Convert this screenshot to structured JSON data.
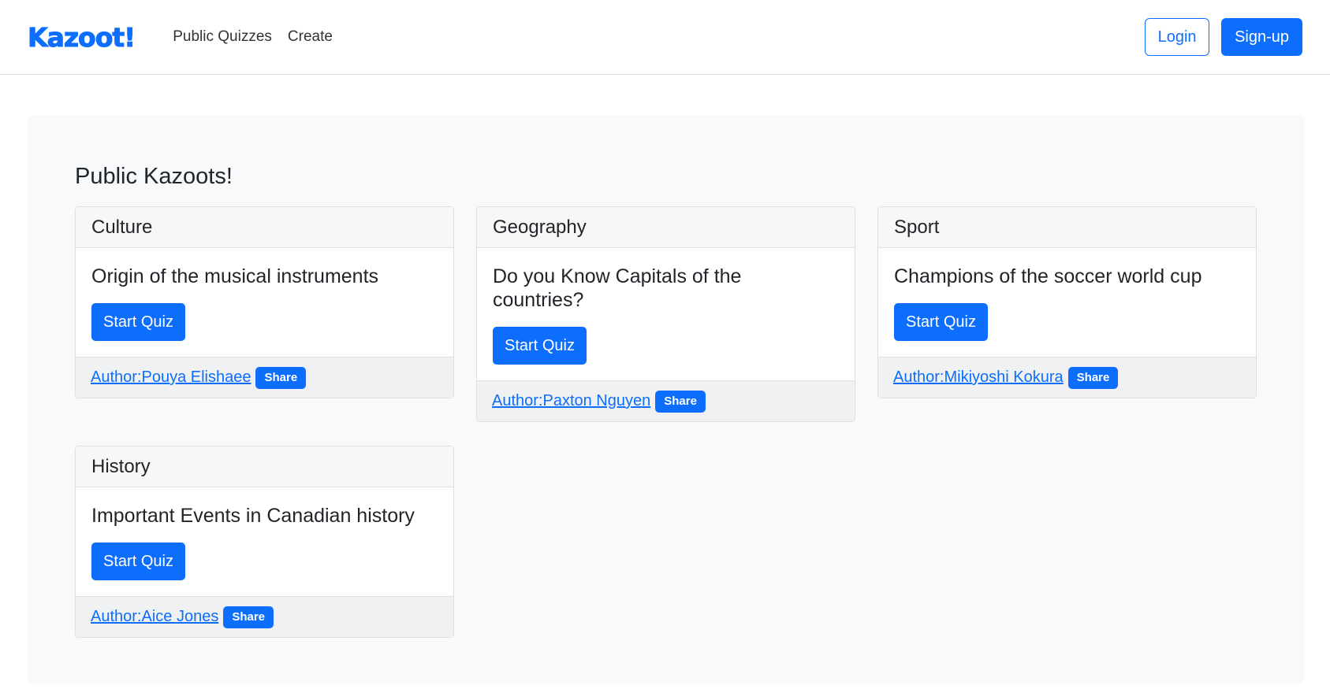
{
  "nav": {
    "brand": "Kazoot!",
    "links": [
      "Public Quizzes",
      "Create"
    ],
    "login_label": "Login",
    "signup_label": "Sign-up"
  },
  "main": {
    "title": "Public Kazoots!",
    "cards": [
      {
        "category": "Culture",
        "quiz_title": "Origin of the musical instruments",
        "button_label": "Start Quiz",
        "author": "Author:Pouya Elishaee",
        "share_label": "Share"
      },
      {
        "category": "Geography",
        "quiz_title": "Do you Know Capitals of the countries?",
        "button_label": "Start Quiz",
        "author": "Author:Paxton Nguyen",
        "share_label": "Share"
      },
      {
        "category": "Sport",
        "quiz_title": "Champions of the soccer world cup",
        "button_label": "Start Quiz",
        "author": "Author:Mikiyoshi Kokura",
        "share_label": "Share"
      },
      {
        "category": "History",
        "quiz_title": "Important Events in Canadian history",
        "button_label": "Start Quiz",
        "author": "Author:Aice Jones",
        "share_label": "Share"
      }
    ]
  },
  "colors": {
    "accent": "#0d6efd",
    "panel_bg": "#f8f9fa"
  }
}
